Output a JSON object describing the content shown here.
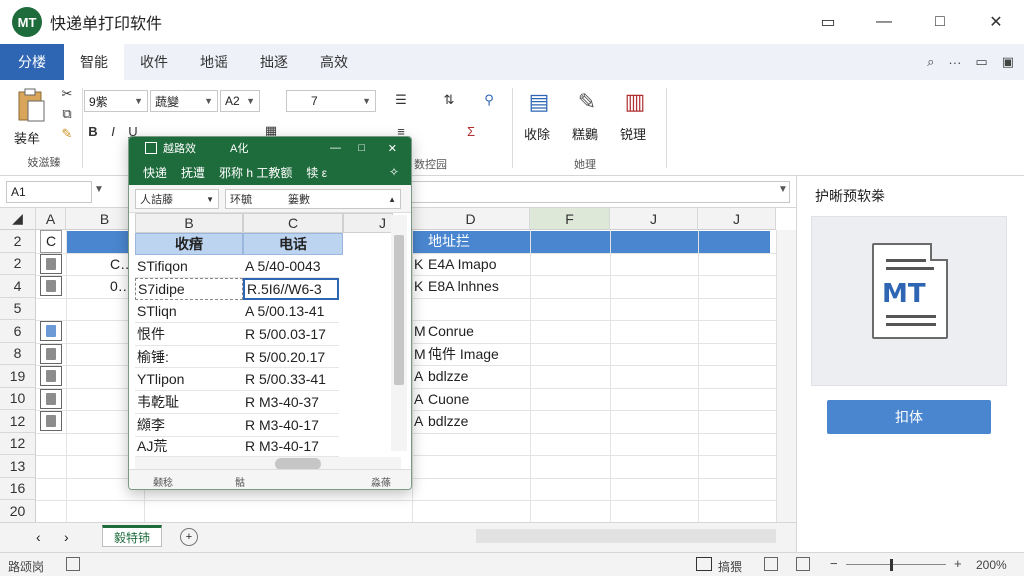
{
  "app": {
    "logo_text": "MT",
    "title": "快递单打印软件"
  },
  "window": {
    "minimize": "▭",
    "maximize": "□",
    "close": "✕"
  },
  "tabs": [
    {
      "label": "分楼",
      "kind": "file"
    },
    {
      "label": "智能",
      "kind": "active"
    },
    {
      "label": "收件"
    },
    {
      "label": "地谣"
    },
    {
      "label": "拙逐"
    },
    {
      "label": "高效"
    }
  ],
  "ribbon": {
    "paste_label": "装牟",
    "clipboard_group": "妓滋臻",
    "font_name": "9紫",
    "font_style": "蔬變",
    "font_size": "A2",
    "bold": "B",
    "italic": "I",
    "underline": "U",
    "number_format": "7",
    "group_2": "数控园",
    "tool_1": "收除",
    "tool_2": "糕鷃",
    "tool_3": "锐理",
    "tools_group": "她理"
  },
  "formula_bar": {
    "name_box": "A1"
  },
  "grid": {
    "columns": [
      "A",
      "B",
      "C",
      "D",
      "F",
      "J",
      "J"
    ],
    "rows": [
      "2",
      "2",
      "4",
      "5",
      "6",
      "8",
      "19",
      "10",
      "12",
      "12",
      "13",
      "16",
      "20"
    ],
    "row2_col_a": "C",
    "header_col_d": "地址拦",
    "col_b_row1": "C…",
    "col_b_row2": "0…",
    "col_d_values": [
      "E4A Imapo",
      "E8A lnhnes",
      "",
      "Conrue",
      "伅件 Image",
      "bdlzze",
      "Cuone",
      "bdlzze"
    ],
    "col_c_prefix": [
      "K",
      "K",
      "",
      "M",
      "M",
      "A",
      "A",
      "A"
    ]
  },
  "sheet": {
    "tab_label": "毅特铈",
    "nav_prev": "‹",
    "nav_next": "›"
  },
  "status": {
    "left": "路颂岗",
    "middle": "搞猥",
    "zoom": "200%"
  },
  "panel": {
    "title": "护晰预软桊",
    "doc_logo": "MT",
    "print_button": "扣体"
  },
  "dialog": {
    "title": "越路效",
    "title_extra": "A化",
    "tabs": [
      "快递",
      "抚遭",
      "邪称 h 工教额",
      "犊 ε"
    ],
    "filter_label": "人詰藤",
    "search_1": "环毓",
    "search_2": "篓數",
    "col_left": "B",
    "col_right": "C",
    "col_far": "J",
    "header_recipient": "收瘖",
    "header_phone": "电话",
    "recipients": [
      "STifiqon",
      "S7idipe",
      "STliqn",
      "恨件",
      "榆锤:",
      "YTlipon",
      "韦乾耻",
      "纐李",
      "AJ荒"
    ],
    "phones": [
      "A 5/40-0043",
      "R.5I6//W6-3",
      "A 5/00.13-41",
      "R 5/00.03-17",
      "R 5/00.20.17",
      "R 5/00.33-41",
      "R M3-40-37",
      "R M3-40-17",
      "R M3-40-17"
    ],
    "status_left": "颡稔",
    "status_mid": "骷",
    "status_right": "淼蓧"
  },
  "colors": {
    "brand_green": "#1e6b3c",
    "file_blue": "#2e66b4",
    "highlight_blue": "#4a86cf",
    "dialog_header": "#bcd4ef"
  }
}
